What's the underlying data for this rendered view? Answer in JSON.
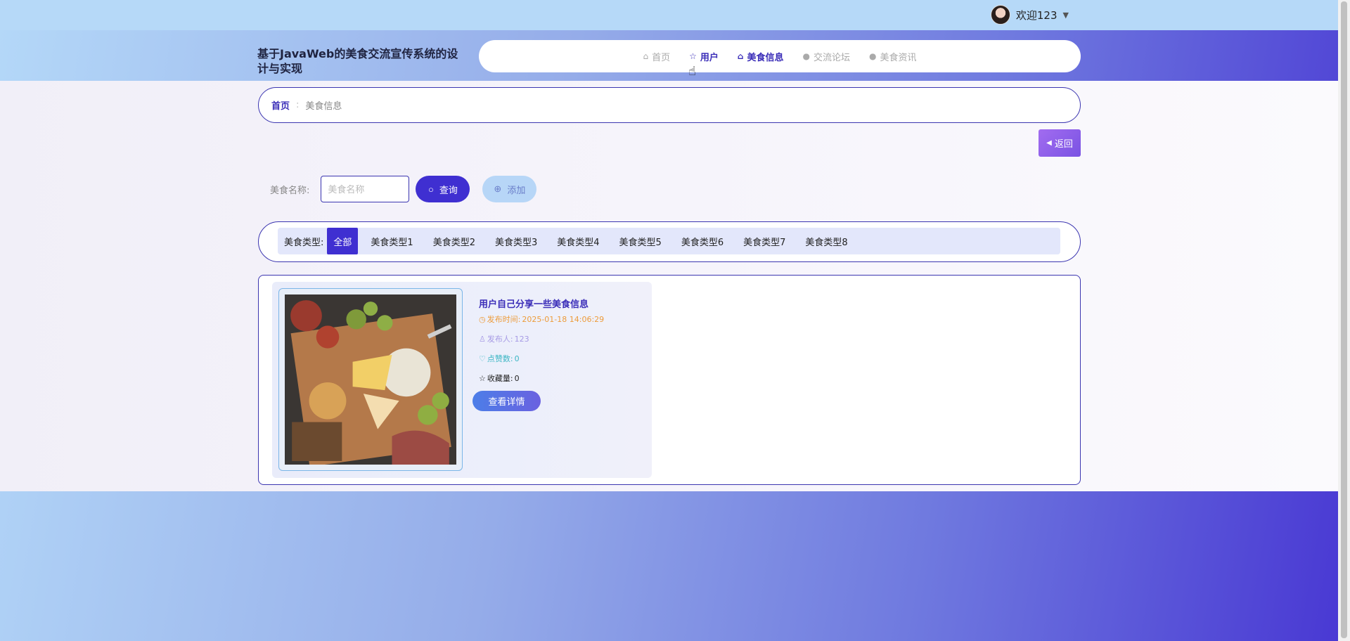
{
  "topbar": {
    "welcome": "欢迎123",
    "caret": "▼"
  },
  "header": {
    "site_title": "基于JavaWeb的美食交流宣传系统的设计与实现",
    "nav": [
      {
        "label": "首页",
        "icon": "⌂"
      },
      {
        "label": "用户",
        "icon": "☆"
      },
      {
        "label": "美食信息",
        "icon": "⌂"
      },
      {
        "label": "交流论坛",
        "icon": "●"
      },
      {
        "label": "美食资讯",
        "icon": "●"
      }
    ]
  },
  "breadcrumb": {
    "home": "首页",
    "separator": ":",
    "current": "美食信息"
  },
  "back_button": {
    "label": "返回",
    "icon": "◀"
  },
  "search": {
    "label": "美食名称:",
    "placeholder": "美食名称",
    "query_label": "查询",
    "add_label": "添加"
  },
  "types": {
    "label": "美食类型:",
    "items": [
      "全部",
      "美食类型1",
      "美食类型2",
      "美食类型3",
      "美食类型4",
      "美食类型5",
      "美食类型6",
      "美食类型7",
      "美食类型8"
    ],
    "selected": "全部"
  },
  "cards": [
    {
      "title": "用户自己分享一些美食信息",
      "time_label": "发布时间:",
      "time": "2025-01-18 14:06:29",
      "author_label": "发布人:",
      "author": "123",
      "likes_label": "点赞数:",
      "likes": "0",
      "favs_label": "收藏量:",
      "favs": "0",
      "detail_label": "查看详情"
    }
  ],
  "colors": {
    "accent": "#3f2fd1",
    "border": "#3b35b0",
    "time": "#ed9c3b",
    "author": "#a79be5",
    "likes": "#3bb6c4"
  }
}
